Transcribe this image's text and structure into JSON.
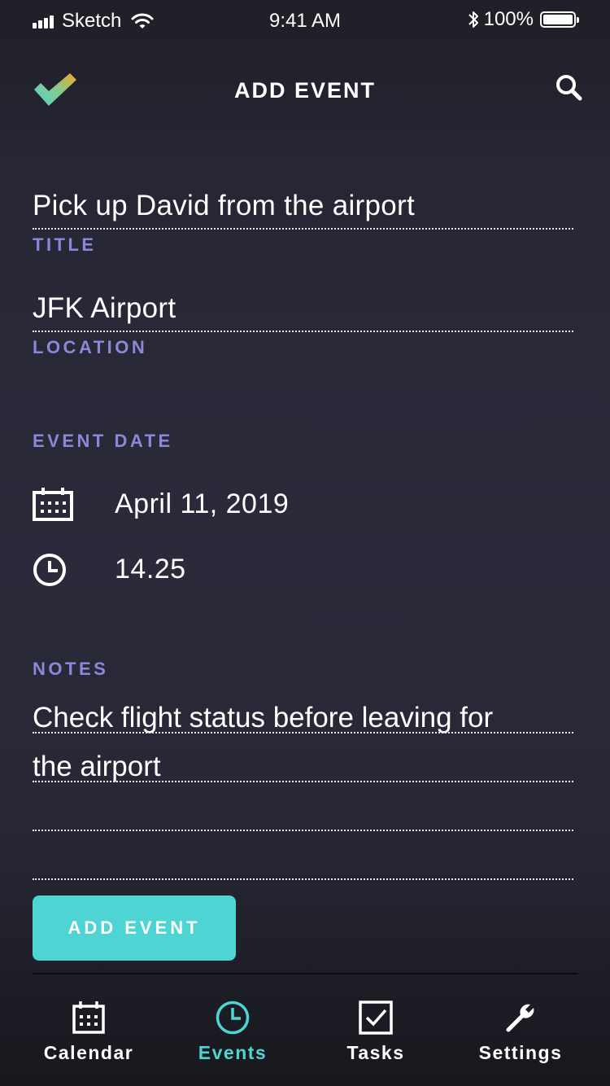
{
  "status_bar": {
    "carrier": "Sketch",
    "time": "9:41 AM",
    "battery": "100%"
  },
  "header": {
    "title": "ADD EVENT",
    "logo_icon": "checkmark-logo-icon",
    "search_icon": "search-icon"
  },
  "form": {
    "title": {
      "value": "Pick up David from the airport",
      "label": "TITLE"
    },
    "location": {
      "value": "JFK Airport",
      "label": "LOCATION"
    },
    "event_date": {
      "label": "EVENT DATE",
      "date": "April 11, 2019",
      "time": "14.25",
      "date_icon": "calendar-icon",
      "time_icon": "clock-icon"
    },
    "notes": {
      "label": "NOTES",
      "lines": [
        "Check flight status before leaving for",
        "the airport",
        "",
        ""
      ]
    },
    "submit_label": "ADD EVENT"
  },
  "tabs": [
    {
      "label": "Calendar",
      "icon": "calendar-icon",
      "active": false
    },
    {
      "label": "Events",
      "icon": "clock-icon",
      "active": true
    },
    {
      "label": "Tasks",
      "icon": "checkbox-icon",
      "active": false
    },
    {
      "label": "Settings",
      "icon": "wrench-icon",
      "active": false
    }
  ],
  "colors": {
    "accent": "#4dd4d3",
    "label": "#8b87d9",
    "background": "#2a2a3a",
    "logo_gradient": [
      "#4dd4d3",
      "#f5a623"
    ]
  }
}
